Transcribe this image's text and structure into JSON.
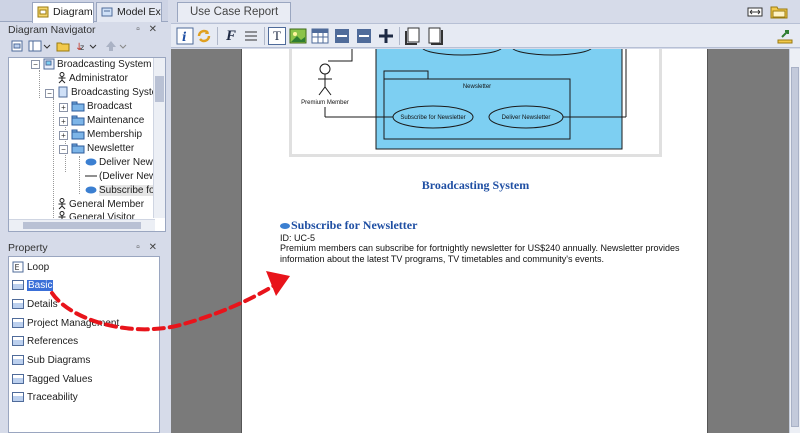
{
  "left_tabs": [
    {
      "label": "Diagram N..."
    },
    {
      "label": "Model Exp..."
    }
  ],
  "navigator": {
    "title": "Diagram Navigator",
    "tree": {
      "root": "Broadcasting System",
      "actor1": "Administrator",
      "system": "Broadcasting System",
      "pkg_broadcast": "Broadcast",
      "pkg_maintenance": "Maintenance",
      "pkg_membership": "Membership",
      "pkg_newsletter": "Newsletter",
      "uc_deliver": "Deliver Newsle",
      "link_deliver": "(Deliver News",
      "uc_subscribe": "Subscribe for",
      "actor2": "General Member",
      "actor3": "General Visitor"
    }
  },
  "property": {
    "title": "Property",
    "items": [
      {
        "label": "Loop"
      },
      {
        "label": "Basic"
      },
      {
        "label": "Details"
      },
      {
        "label": "Project Management"
      },
      {
        "label": "References"
      },
      {
        "label": "Sub Diagrams"
      },
      {
        "label": "Tagged Values"
      },
      {
        "label": "Traceability"
      }
    ]
  },
  "doc_tab": {
    "label": "Use Case Report"
  },
  "toolbar": {
    "text_style_glyph": "F",
    "text_glyph": "T"
  },
  "diagram": {
    "package_label": "Newsletter",
    "actor_label": "Premium Member",
    "uc_subscribe": "Subscribe for Newsletter",
    "uc_deliver": "Deliver Newsletter"
  },
  "report": {
    "caption": "Broadcasting System",
    "uc_title": "Subscribe for Newsletter",
    "uc_id": "ID: UC-5",
    "uc_desc_line1": "Premium members can subscribe for fortnightly newsletter for US$240 annually. Newsletter provides",
    "uc_desc_line2": "information about the latest TV programs, TV timetables and community's events."
  },
  "colors": {
    "accent_blue": "#1f4fa3",
    "selection": "#3a6fd8",
    "package_fill": "#7dcff2",
    "arrow_red": "#e8141b"
  }
}
